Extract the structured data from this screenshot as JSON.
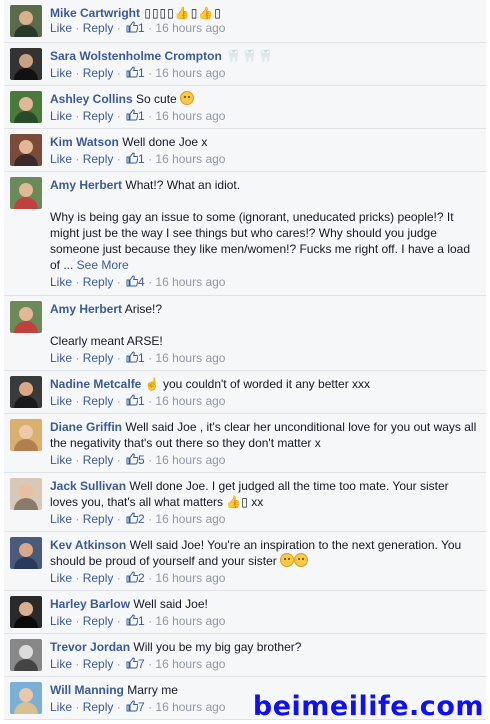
{
  "actions": {
    "like": "Like",
    "reply": "Reply",
    "dot": " · "
  },
  "comments": [
    {
      "name": "Mike Cartwright",
      "text": " ▯▯▯▯👍▯👍▯",
      "likes": "1",
      "time": "16 hours ago",
      "avatar_bg": "#5a6a4a",
      "avatar_skin": "#d8b08c"
    },
    {
      "name": "Sara Wolstenholme Crompton",
      "text": " 🦷🦷🦷",
      "likes": "1",
      "time": "16 hours ago",
      "avatar_bg": "#333333",
      "avatar_skin": "#c9a080"
    },
    {
      "name": "Ashley Collins",
      "text": " So cute ",
      "likes": "1",
      "time": "16 hours ago",
      "avatar_bg": "#4a7a3a",
      "avatar_skin": "#e0b898"
    },
    {
      "name": "Kim Watson",
      "text": " Well done Joe x",
      "likes": "1",
      "time": "16 hours ago",
      "avatar_bg": "#7a4a3a",
      "avatar_skin": "#e2b696"
    },
    {
      "name": "Amy Herbert",
      "text": " What!? What an idiot.",
      "para": "Why is being gay an issue to some (ignorant, uneducated pricks) people!? It might just be the way I see things but who cares!? Why should you judge someone just because they like men/women!? Fucks me right off. I have a load of ...",
      "see_more": " See More",
      "likes": "4",
      "time": "16 hours ago",
      "avatar_bg": "#6a8a5a",
      "avatar_skin": "#e2b898"
    },
    {
      "name": "Amy Herbert",
      "text": " Arise!?",
      "para": "Clearly meant ARSE!",
      "likes": "1",
      "time": "16 hours ago",
      "avatar_bg": "#6a8a5a",
      "avatar_skin": "#e2b898"
    },
    {
      "name": "Nadine Metcalfe",
      "text": "  ☝  you couldn't of worded it any better xxx",
      "likes": "1",
      "time": "16 hours ago",
      "avatar_bg": "#3a3a3a",
      "avatar_skin": "#d8a888"
    },
    {
      "name": "Diane Griffin",
      "text": " Well said Joe , it's clear her unconditional love for you out ways all the negativity that's out there so they don't matter x",
      "likes": "5",
      "time": "16 hours ago",
      "avatar_bg": "#d8b070",
      "avatar_skin": "#f0c8a8"
    },
    {
      "name": "Jack Sullivan",
      "text": " Well done Joe. I get judged all the time too mate. Your sister loves you, that's all what matters 👍▯ xx",
      "likes": "2",
      "time": "16 hours ago",
      "avatar_bg": "#d8c8b8",
      "avatar_skin": "#e8c0a0"
    },
    {
      "name": "Kev Atkinson",
      "text": " Well said Joe! You're an inspiration to the next generation. You should be proud of yourself and your sister ",
      "likes": "2",
      "time": "16 hours ago",
      "avatar_bg": "#4a5a7a",
      "avatar_skin": "#d8a888"
    },
    {
      "name": "Harley Barlow",
      "text": " Well said Joe!",
      "likes": "1",
      "time": "16 hours ago",
      "avatar_bg": "#2a2a2a",
      "avatar_skin": "#d8b090"
    },
    {
      "name": "Trevor Jordan",
      "text": " Will you be my big gay brother?",
      "likes": "7",
      "time": "16 hours ago",
      "avatar_bg": "#888888",
      "avatar_skin": "#dcdcdc"
    },
    {
      "name": "Will Manning",
      "text": " Marry me",
      "likes": "7",
      "time": "16 hours ago",
      "avatar_bg": "#7ab0d8",
      "avatar_skin": "#e8c8a8"
    }
  ],
  "watermark": "beimeilife.com"
}
